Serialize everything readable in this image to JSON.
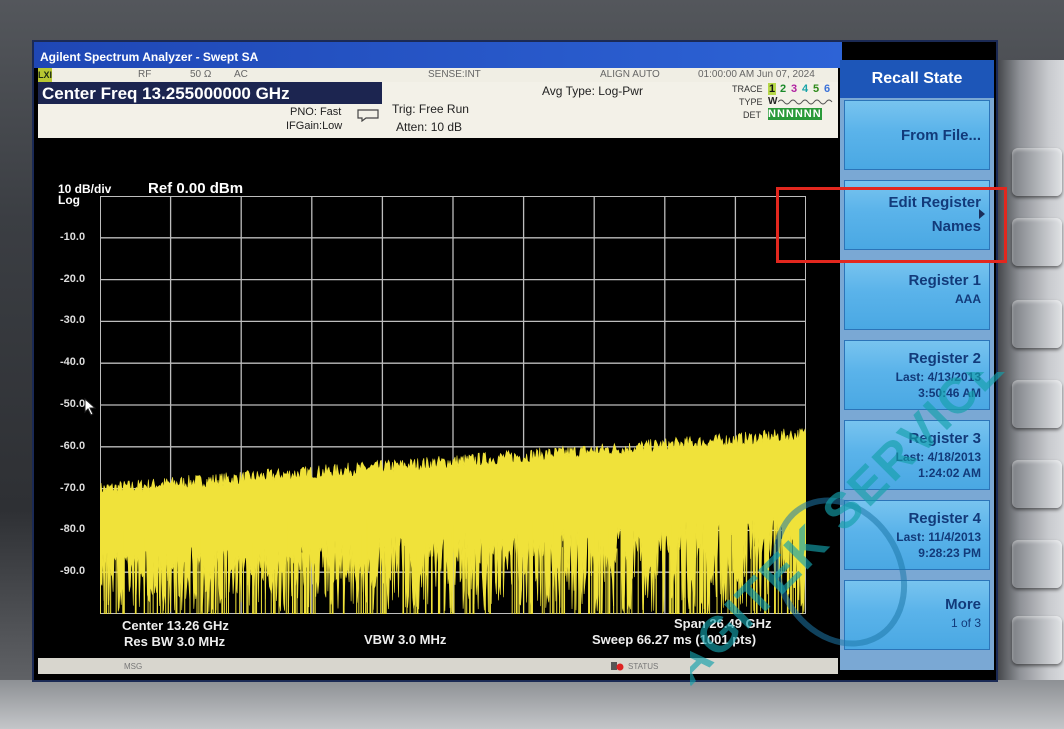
{
  "app": {
    "title": "Agilent Spectrum Analyzer - Swept SA"
  },
  "status_row": {
    "lxi": "LXI",
    "rf": "RF",
    "impedance": "50 Ω",
    "coupling": "AC",
    "sense": "SENSE:INT",
    "align": "ALIGN AUTO",
    "datetime": "01:00:00 AM Jun 07, 2024"
  },
  "header": {
    "center_freq": "Center Freq 13.255000000 GHz",
    "pno": "PNO: Fast",
    "ifgain": "IFGain:Low",
    "trig": "Trig: Free Run",
    "atten": "Atten: 10 dB",
    "avg_type": "Avg Type: Log-Pwr",
    "trace_label": "TRACE",
    "type_label": "TYPE",
    "det_label": "DET",
    "trace_nums": [
      "1",
      "2",
      "3",
      "4",
      "5",
      "6"
    ],
    "type_value": "W",
    "det_value": "NNNNNN"
  },
  "plot": {
    "scale": "10 dB/div",
    "scale_type": "Log",
    "ref_level": "Ref 0.00 dBm",
    "y_labels": [
      "-10.0",
      "-20.0",
      "-30.0",
      "-40.0",
      "-50.0",
      "-60.0",
      "-70.0",
      "-80.0",
      "-90.0"
    ],
    "trace_color": "#f0e23a"
  },
  "footer": {
    "center": "Center 13.26 GHz",
    "res_bw": "Res BW 3.0 MHz",
    "vbw": "VBW 3.0 MHz",
    "span": "Span 26.49 GHz",
    "sweep": "Sweep  66.27 ms (1001 pts)"
  },
  "msgbar": {
    "msg": "MSG",
    "status": "STATUS"
  },
  "softkeys": {
    "title": "Recall State",
    "items": [
      {
        "main": "From File...",
        "sub1": "",
        "sub2": ""
      },
      {
        "main": "Edit Register",
        "main2": "Names",
        "sub1": "",
        "sub2": ""
      },
      {
        "main": "Register 1",
        "sub1": "AAA",
        "sub2": ""
      },
      {
        "main": "Register 2",
        "sub1": "Last: 4/13/2013",
        "sub2": "3:50:46 AM"
      },
      {
        "main": "Register 3",
        "sub1": "Last: 4/18/2013",
        "sub2": "1:24:02 AM"
      },
      {
        "main": "Register 4",
        "sub1": "Last: 11/4/2013",
        "sub2": "9:28:23 PM"
      },
      {
        "main": "More",
        "sub1": "1 of 3",
        "sub2": ""
      }
    ]
  },
  "watermark": {
    "text": "AGITEK SERVICE"
  }
}
